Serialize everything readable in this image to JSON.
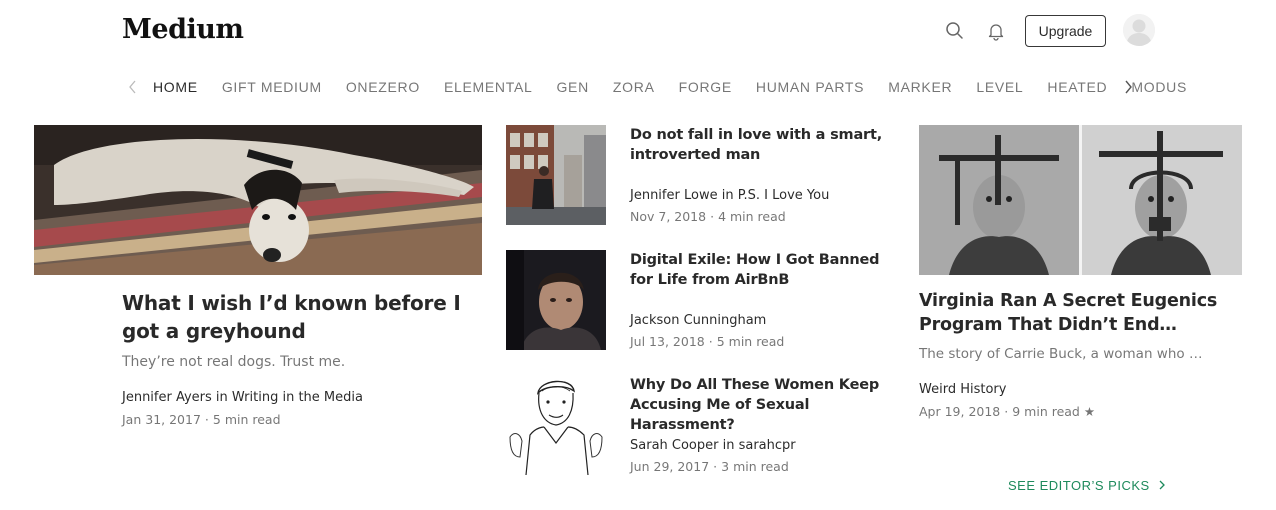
{
  "header": {
    "logo": "Medium",
    "upgrade_label": "Upgrade",
    "icons": [
      "search-icon",
      "bell-icon",
      "avatar"
    ]
  },
  "nav": {
    "items": [
      "HOME",
      "GIFT MEDIUM",
      "ONEZERO",
      "ELEMENTAL",
      "GEN",
      "ZORA",
      "FORGE",
      "HUMAN PARTS",
      "MARKER",
      "LEVEL",
      "HEATED",
      "MODUS"
    ],
    "active": "HOME"
  },
  "featured": {
    "title": "What I wish I’d known before I got a greyhound",
    "subtitle": "They’re not real dogs. Trust me.",
    "author": "Jennifer Ayers in Writing in the Media",
    "date": "Jan 31, 2017",
    "read_time": "5 min read"
  },
  "middle": [
    {
      "title": "Do not fall in love with a smart, introverted man",
      "author": "Jennifer Lowe in P.S. I Love You",
      "date": "Nov 7, 2018",
      "read_time": "4 min read"
    },
    {
      "title": "Digital Exile: How I Got Banned for Life from AirBnB",
      "author": "Jackson Cunningham",
      "date": "Jul 13, 2018",
      "read_time": "5 min read"
    },
    {
      "title": "Why Do All These Women Keep Accusing Me of Sexual Harassment?",
      "author": "Sarah Cooper in sarahcpr",
      "date": "Jun 29, 2017",
      "read_time": "3 min read"
    }
  ],
  "right": {
    "title": "Virginia Ran A Secret Eugenics Program That Didn’t End…",
    "subtitle": "The story of Carrie Buck, a woman who …",
    "author": "Weird History",
    "date": "Apr 19, 2018",
    "read_time": "9 min read",
    "star": "★"
  },
  "editors_picks_label": "SEE EDITOR’S PICKS",
  "colors": {
    "accent": "#1e8a5c"
  }
}
